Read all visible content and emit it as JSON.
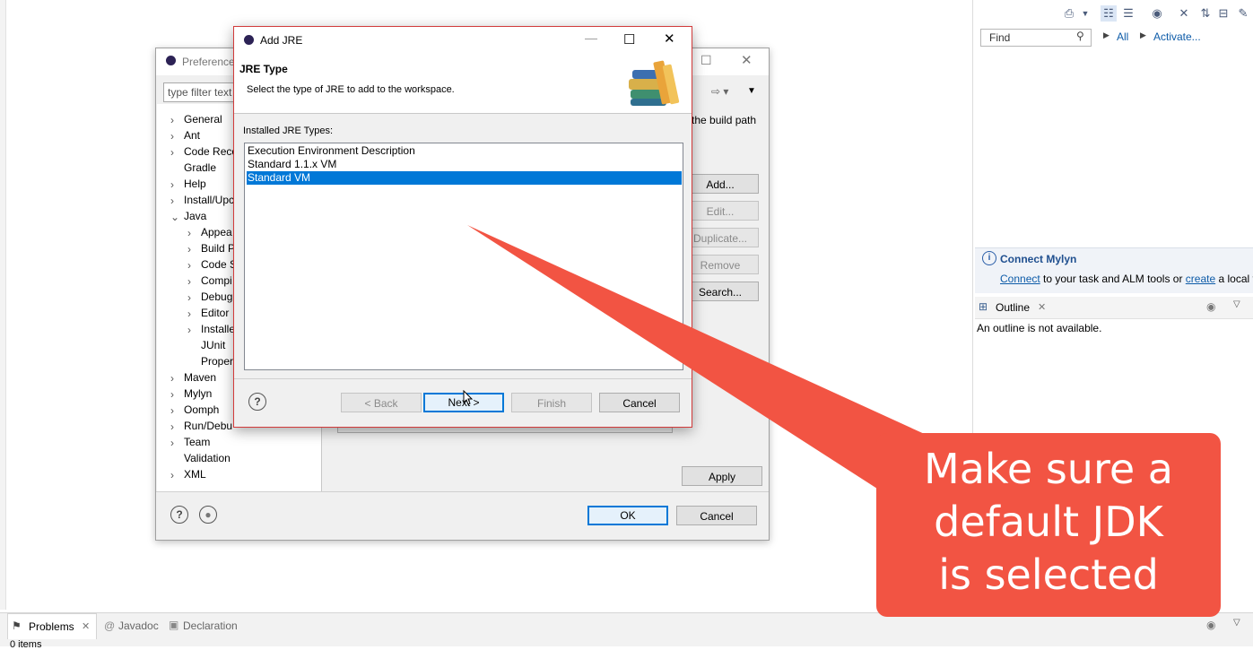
{
  "right_panel": {
    "find_placeholder": "Find",
    "all_label": "All",
    "activate_label": "Activate...",
    "mylyn_title": "Connect Mylyn",
    "mylyn_connect": "Connect",
    "mylyn_text_mid": " to your task and ALM tools or ",
    "mylyn_create": "create",
    "mylyn_text_end": " a local t",
    "outline_tab": "Outline",
    "outline_message": "An outline is not available."
  },
  "bottom_bar": {
    "problems_tab": "Problems",
    "javadoc_tab": "Javadoc",
    "declaration_tab": "Declaration",
    "status": "0 items"
  },
  "preferences": {
    "title": "Preference",
    "filter_placeholder": "type filter text",
    "tree": [
      {
        "label": "General",
        "arrow": "›"
      },
      {
        "label": "Ant",
        "arrow": "›"
      },
      {
        "label": "Code Reco",
        "arrow": "›"
      },
      {
        "label": "Gradle",
        "arrow": ""
      },
      {
        "label": "Help",
        "arrow": "›"
      },
      {
        "label": "Install/Upc",
        "arrow": "›"
      },
      {
        "label": "Java",
        "arrow": "⌄"
      },
      {
        "label": "Appea",
        "arrow": "›"
      },
      {
        "label": "Build P",
        "arrow": "›"
      },
      {
        "label": "Code S",
        "arrow": "›"
      },
      {
        "label": "Compi",
        "arrow": "›"
      },
      {
        "label": "Debug",
        "arrow": "›"
      },
      {
        "label": "Editor",
        "arrow": "›"
      },
      {
        "label": "Installe",
        "arrow": "›"
      },
      {
        "label": "JUnit",
        "arrow": ""
      },
      {
        "label": "Proper",
        "arrow": ""
      },
      {
        "label": "Maven",
        "arrow": "›"
      },
      {
        "label": "Mylyn",
        "arrow": "›"
      },
      {
        "label": "Oomph",
        "arrow": "›"
      },
      {
        "label": "Run/Debu",
        "arrow": "›"
      },
      {
        "label": "Team",
        "arrow": "›"
      },
      {
        "label": "Validation",
        "arrow": ""
      },
      {
        "label": "XML",
        "arrow": "›"
      }
    ],
    "build_path_text": "the build path",
    "buttons": {
      "add": "Add...",
      "edit": "Edit...",
      "duplicate": "Duplicate...",
      "remove": "Remove",
      "search": "Search...",
      "apply": "Apply",
      "ok": "OK",
      "cancel": "Cancel"
    }
  },
  "add_jre": {
    "title": "Add JRE",
    "heading": "JRE Type",
    "description": "Select the type of JRE to add to the workspace.",
    "list_label": "Installed JRE Types:",
    "items": [
      {
        "label": "Execution Environment Description",
        "selected": false
      },
      {
        "label": "Standard 1.1.x VM",
        "selected": false
      },
      {
        "label": "Standard VM",
        "selected": true
      }
    ],
    "buttons": {
      "back": "< Back",
      "next": "Next >",
      "finish": "Finish",
      "cancel": "Cancel"
    }
  },
  "callout": {
    "line1": "Make sure a",
    "line2": "default JDK",
    "line3": "is selected",
    "color": "#f25443"
  },
  "colors": {
    "selection": "#0078d7",
    "link": "#0d5ba8"
  }
}
